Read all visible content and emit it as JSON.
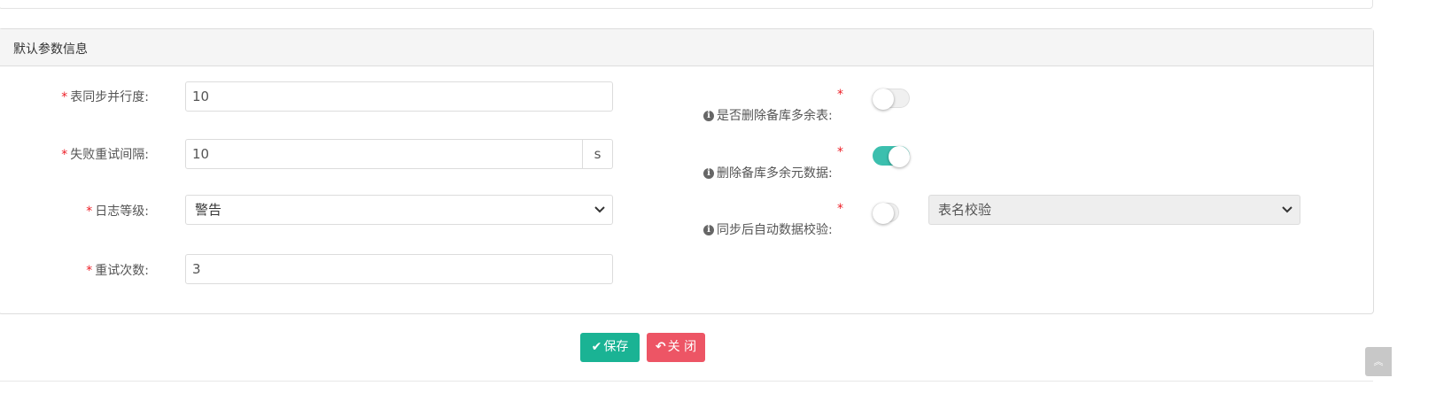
{
  "panel": {
    "title": "默认参数信息"
  },
  "form_left": [
    {
      "label": "表同步并行度:",
      "value": "10"
    },
    {
      "label": "失败重试间隔:",
      "value": "10",
      "addon": "s"
    },
    {
      "label": "日志等级:",
      "selected": "警告"
    },
    {
      "label": "重试次数:",
      "value": "3"
    }
  ],
  "form_right": [
    {
      "label": "是否删除备库多余表:",
      "toggle": "off"
    },
    {
      "label": "删除备库多余元数据:",
      "toggle": "on"
    },
    {
      "label": "同步后自动数据校验:",
      "toggle": "off",
      "selected": "表名校验",
      "select_disabled": true
    }
  ],
  "required_mark": "*",
  "buttons": {
    "save": "保存",
    "close": "关 闭"
  },
  "icons": {
    "info": "info-circle-icon",
    "save": "check-icon",
    "close": "reply-icon",
    "back_to_top": "double-chevron-up-icon",
    "dropdown": "chevron-down-icon"
  },
  "colors": {
    "toggle_on": "#3cbfae",
    "save_button": "#1ab394",
    "close_button": "#ed5565",
    "required": "#ed1c24"
  }
}
